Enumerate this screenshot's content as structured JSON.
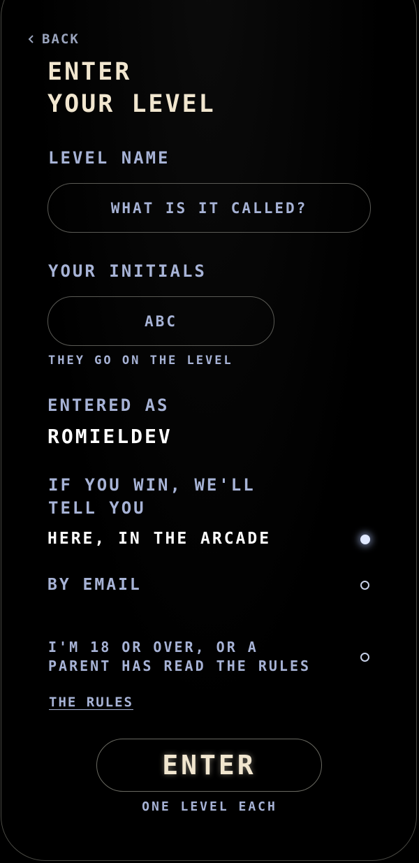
{
  "nav": {
    "back_label": "BACK"
  },
  "header": {
    "title_line1": "ENTER",
    "title_line2": "YOUR LEVEL"
  },
  "form": {
    "level_name": {
      "label": "LEVEL NAME",
      "placeholder": "WHAT IS IT CALLED?",
      "value": ""
    },
    "initials": {
      "label": "YOUR INITIALS",
      "placeholder": "ABC",
      "value": "",
      "hint": "THEY GO ON THE LEVEL"
    },
    "entered_as": {
      "label": "ENTERED AS",
      "value": "ROMIELDEV"
    },
    "notify": {
      "label_line1": "IF YOU WIN, WE'LL",
      "label_line2": "TELL YOU",
      "options": [
        {
          "label": "HERE, IN THE ARCADE",
          "selected": true
        },
        {
          "label": "BY EMAIL",
          "selected": false
        }
      ]
    },
    "consent": {
      "line1": "I'M 18 OR OVER, OR A",
      "line2": "PARENT HAS READ THE RULES",
      "checked": false
    },
    "rules_link": "THE RULES"
  },
  "footer": {
    "enter_label": "ENTER",
    "note": "ONE LEVEL EACH"
  },
  "colors": {
    "background": "#000000",
    "title": "#f1e6cf",
    "label": "#a7b3d6",
    "value": "#ffffff",
    "border": "#5a5a55",
    "radio_selected": "#dfe8ff"
  }
}
